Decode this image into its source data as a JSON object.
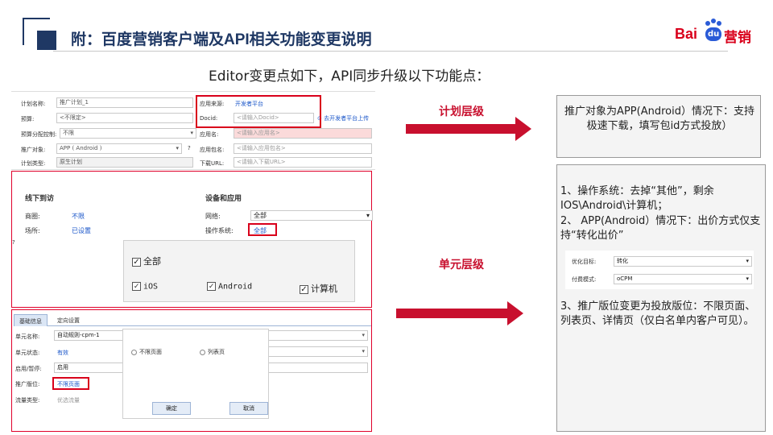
{
  "header": {
    "title": "附：百度营销客户端及API相关功能变更说明",
    "logo": {
      "left": "Bai",
      "paw": "du",
      "right": "营销"
    }
  },
  "subtitle": "Editor变更点如下，API同步升级以下功能点：",
  "plan_form": {
    "labels": [
      "计划名称:",
      "预算:",
      "预算分配控制:",
      "推广对象:",
      "计划类型:"
    ],
    "plan_name": "推广计划_1",
    "budget": "<不限定>",
    "budget_control": "不限",
    "promo_target": "APP ( Android )",
    "plan_type": "原生计划",
    "right_labels": [
      "应用来源:",
      "Docid:",
      "应用名:",
      "应用包名:",
      "下载URL:"
    ],
    "app_source": "开发者平台",
    "docid_placeholder": "<请输入Docid>",
    "dev_link": "去开发者平台上传",
    "app_name_placeholder": "<请输入应用名>",
    "package_placeholder": "<请输入应用包名>",
    "url_placeholder": "<请输入下载URL>"
  },
  "targeting": {
    "offline_title": "线下到访",
    "device_title": "设备和应用",
    "rows": [
      {
        "label": "商圈:",
        "value": "不限"
      },
      {
        "label": "场所:",
        "value": "已设置"
      }
    ],
    "network_label": "网络:",
    "network_value": "全部",
    "os_label": "操作系统:",
    "os_value": "全部",
    "popup": {
      "all": "全部",
      "options": [
        "iOS",
        "Android",
        "计算机"
      ]
    }
  },
  "unit_form": {
    "tabs": [
      "基础信息",
      "定向设置"
    ],
    "labels": [
      "单元名称:",
      "单元状态:",
      "启用/暂停:",
      "推广版位:",
      "流量类型:"
    ],
    "unit_name": "自动规则-cpm-1",
    "status": "有效",
    "enable": "启用",
    "placement": "不限页面",
    "traffic": "优选流量",
    "popup": {
      "options": [
        "不限页面",
        "列表页"
      ],
      "ok": "确定",
      "cancel": "取消"
    }
  },
  "arrows": {
    "plan_label": "计划层级",
    "unit_label": "单元层级"
  },
  "callouts": {
    "plan": "推广对象为APP(Android）情况下：支持极速下载，填写包id方式投放）",
    "unit_1": "1、操作系统：去掉“其他”，剩余IOS\\Android\\计算机；",
    "unit_2": "2、 APP(Android）情况下：出价方式仅支持“转化出价”",
    "bid_labels": [
      "优化目标:",
      "付费模式:"
    ],
    "bid_values": [
      "转化",
      "oCPM"
    ],
    "unit_3": "3、推广版位变更为投放版位：不限页面、列表页、详情页（仅白名单内客户可见）。"
  },
  "colors": {
    "brand_red": "#c8102e",
    "header_blue": "#1f3864",
    "link_blue": "#1a56c9"
  }
}
